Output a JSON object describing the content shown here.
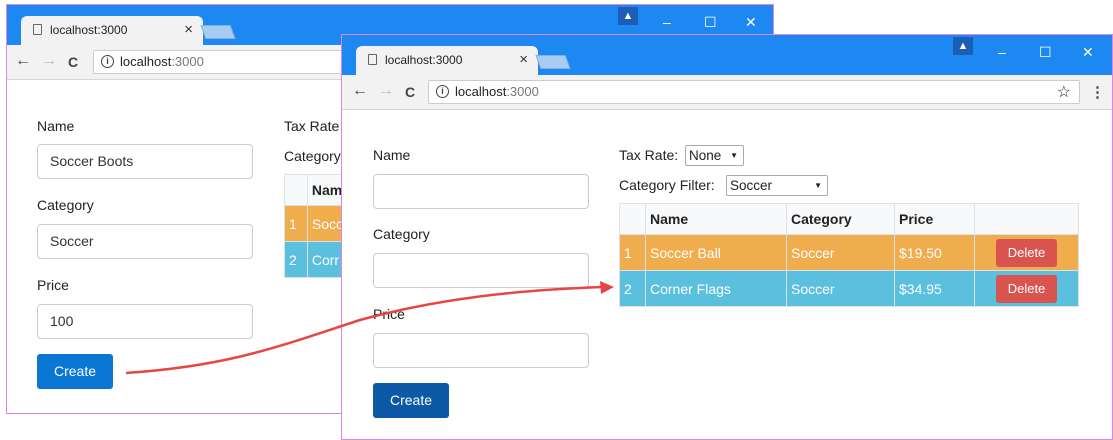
{
  "window_back": {
    "tab_title": "localhost:3000",
    "url_host": "localhost",
    "url_port": ":3000",
    "form": {
      "name_label": "Name",
      "name_value": "Soccer Boots",
      "category_label": "Category",
      "category_value": "Soccer",
      "price_label": "Price",
      "price_value": "100",
      "create_label": "Create"
    },
    "partial": {
      "tax_rate": "Tax Rate",
      "category": "Category",
      "name_header": "Nam",
      "row1_index": "1",
      "row1_name": "Socc",
      "row2_index": "2",
      "row2_name": "Corr"
    }
  },
  "window_front": {
    "tab_title": "localhost:3000",
    "url_host": "localhost",
    "url_port": ":3000",
    "form": {
      "name_label": "Name",
      "category_label": "Category",
      "price_label": "Price",
      "create_label": "Create"
    },
    "tax_rate_label": "Tax Rate:",
    "tax_rate_value": "None",
    "category_filter_label": "Category Filter:",
    "category_filter_value": "Soccer",
    "table": {
      "headers": [
        "",
        "Name",
        "Category",
        "Price",
        ""
      ],
      "rows": [
        {
          "index": "1",
          "name": "Soccer Ball",
          "category": "Soccer",
          "price": "$19.50",
          "action": "Delete"
        },
        {
          "index": "2",
          "name": "Corner Flags",
          "category": "Soccer",
          "price": "$34.95",
          "action": "Delete"
        }
      ]
    }
  },
  "icons": {
    "minimize": "–",
    "maximize": "☐",
    "close": "✕",
    "tab_close": "×",
    "back": "←",
    "forward": "→",
    "reload": "C",
    "star": "☆",
    "menu": "⋮",
    "user": "▲"
  },
  "colors": {
    "titlebar": "#1e88f2",
    "row_warning": "#f0ad4e",
    "row_info": "#5bc0de",
    "delete_button": "#d9534f",
    "create_button_back": "#0a77d5",
    "create_button_front": "#0c5aa6",
    "arrow": "#e84545"
  }
}
